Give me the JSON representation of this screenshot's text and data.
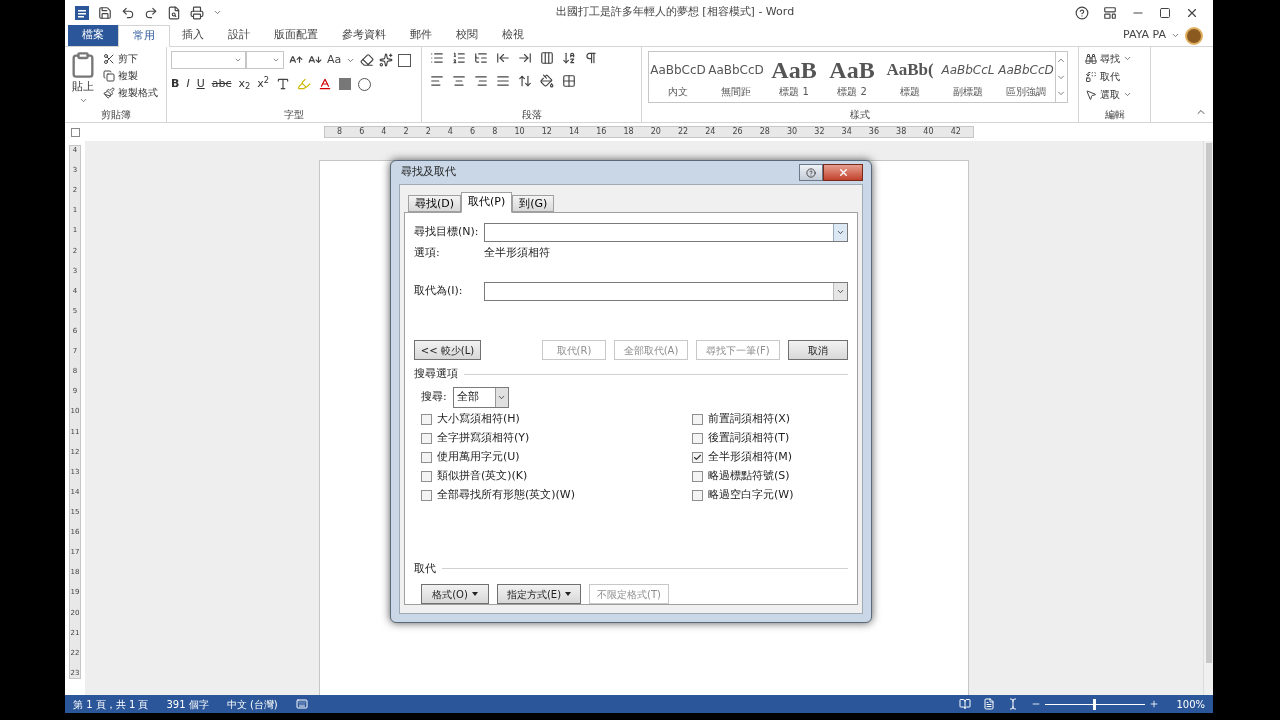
{
  "window": {
    "title": "出國打工是許多年輕人的夢想 [相容模式] - Word"
  },
  "ribbon_tabs": [
    {
      "label": "檔案",
      "kind": "file",
      "selected": false
    },
    {
      "label": "常用",
      "kind": "tab",
      "selected": true
    },
    {
      "label": "插入",
      "kind": "tab",
      "selected": false
    },
    {
      "label": "設計",
      "kind": "tab",
      "selected": false
    },
    {
      "label": "版面配置",
      "kind": "tab",
      "selected": false
    },
    {
      "label": "參考資料",
      "kind": "tab",
      "selected": false
    },
    {
      "label": "郵件",
      "kind": "tab",
      "selected": false
    },
    {
      "label": "校閱",
      "kind": "tab",
      "selected": false
    },
    {
      "label": "檢視",
      "kind": "tab",
      "selected": false
    }
  ],
  "account": {
    "name": "PAYA PA"
  },
  "clipboard": {
    "label": "剪貼簿",
    "paste": "貼上",
    "commands": [
      "剪下",
      "複製",
      "複製格式"
    ]
  },
  "font": {
    "label": "字型",
    "case_button": "Aa",
    "format_buttons": [
      "B",
      "I",
      "U",
      "abc",
      "x$_{2}$",
      "x$^{2}$"
    ]
  },
  "paragraph": {
    "label": "段落"
  },
  "styles": {
    "label": "樣式",
    "items": [
      {
        "preview": "AaBbCcD",
        "name": "內文",
        "kind": "normal"
      },
      {
        "preview": "AaBbCcD",
        "name": "無間距",
        "kind": "normal"
      },
      {
        "preview": "AaB",
        "name": "標題 1",
        "kind": "heading"
      },
      {
        "preview": "AaB",
        "name": "標題 2",
        "kind": "heading"
      },
      {
        "preview": "AaBb(",
        "name": "標題",
        "kind": "title"
      },
      {
        "preview": "AaBbCcL",
        "name": "副標題",
        "kind": "italic"
      },
      {
        "preview": "AaBbCcD",
        "name": "區別強調",
        "kind": "italic"
      }
    ]
  },
  "editing": {
    "label": "編輯",
    "commands": [
      {
        "label": "尋找",
        "menu": true
      },
      {
        "label": "取代",
        "menu": false
      },
      {
        "label": "選取",
        "menu": true
      }
    ]
  },
  "ruler": {
    "horizontal": [
      "8",
      "6",
      "4",
      "2",
      "2",
      "4",
      "6",
      "8",
      "10",
      "12",
      "14",
      "16",
      "18",
      "20",
      "22",
      "24",
      "26",
      "28",
      "30",
      "32",
      "34",
      "36",
      "38",
      "40",
      "42"
    ],
    "vertical": [
      "4",
      "3",
      "2",
      "1",
      "1",
      "2",
      "3",
      "4",
      "5",
      "6",
      "7",
      "8",
      "9",
      "10",
      "11",
      "12",
      "13",
      "14",
      "15",
      "16",
      "17",
      "18",
      "19",
      "20",
      "21",
      "22",
      "23"
    ]
  },
  "dialog": {
    "title": "尋找及取代",
    "tabs": [
      {
        "label": "尋找(D)",
        "selected": false
      },
      {
        "label": "取代(P)",
        "selected": true
      },
      {
        "label": "到(G)",
        "selected": false
      }
    ],
    "find_label": "尋找目標(N):",
    "options_label": "選項:",
    "options_value": "全半形須相符",
    "replace_label": "取代為(I):",
    "less_button": "<< 較少(L)",
    "actions": [
      {
        "label": "取代(R)",
        "disabled": true
      },
      {
        "label": "全部取代(A)",
        "disabled": true
      },
      {
        "label": "尋找下一筆(F)",
        "disabled": true
      },
      {
        "label": "取消",
        "disabled": false
      }
    ],
    "search_options": {
      "heading": "搜尋選項",
      "search_label": "搜尋:",
      "search_value": "全部",
      "left": [
        {
          "label": "大小寫須相符(H)",
          "checked": false
        },
        {
          "label": "全字拼寫須相符(Y)",
          "checked": false
        },
        {
          "label": "使用萬用字元(U)",
          "checked": false
        },
        {
          "label": "類似拼音(英文)(K)",
          "checked": false
        },
        {
          "label": "全部尋找所有形態(英文)(W)",
          "checked": false
        }
      ],
      "right": [
        {
          "label": "前置詞須相符(X)",
          "checked": false
        },
        {
          "label": "後置詞須相符(T)",
          "checked": false
        },
        {
          "label": "全半形須相符(M)",
          "checked": true
        },
        {
          "label": "略過標點符號(S)",
          "checked": false
        },
        {
          "label": "略過空白字元(W)",
          "checked": false
        }
      ]
    },
    "replace_section": {
      "heading": "取代",
      "buttons": [
        {
          "label": "格式(O)",
          "menu": true,
          "disabled": false
        },
        {
          "label": "指定方式(E)",
          "menu": true,
          "disabled": false
        },
        {
          "label": "不限定格式(T)",
          "menu": false,
          "disabled": true
        }
      ]
    }
  },
  "status_bar": {
    "page": "第 1 頁，共 1 頁",
    "words": "391 個字",
    "language": "中文 (台灣)",
    "zoom": "100%",
    "zoom_slider": {
      "level": 0.5
    }
  }
}
